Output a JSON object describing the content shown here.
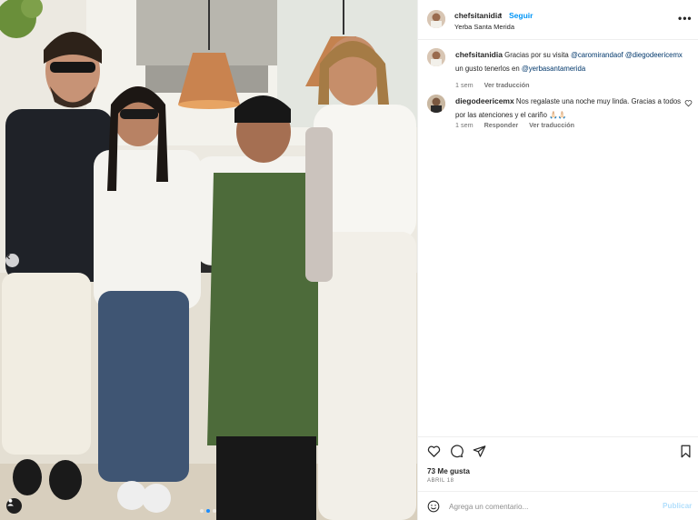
{
  "header": {
    "username": "chefsitanidia",
    "separator": "•",
    "follow_label": "Seguir",
    "location": "Yerba Santa Merida",
    "more_icon": "more-horizontal-icon"
  },
  "comments": [
    {
      "username": "chefsitanidia",
      "pre": "Gracias por su visita ",
      "mention1": "@caromirandaof",
      "mention2": "@diegodeericemx",
      "mid": " un gusto tenerlos en ",
      "mention3": "@yerbasantamerida",
      "time": "1 sem",
      "translate": "Ver traducción"
    },
    {
      "username": "diegodeericemx",
      "text": "Nos regalaste una noche muy linda. Gracias a todos por las atenciones y el cariño 🙏🏻🙏🏻",
      "time": "1 sem",
      "reply": "Responder",
      "translate": "Ver traducción"
    }
  ],
  "actions": {
    "likes": "73 Me gusta",
    "date": "ABRIL 18"
  },
  "comment_box": {
    "placeholder": "Agrega un comentario...",
    "publish": "Publicar"
  },
  "colors": {
    "link": "#0095f6",
    "mention": "#00376b",
    "muted": "#737373"
  }
}
